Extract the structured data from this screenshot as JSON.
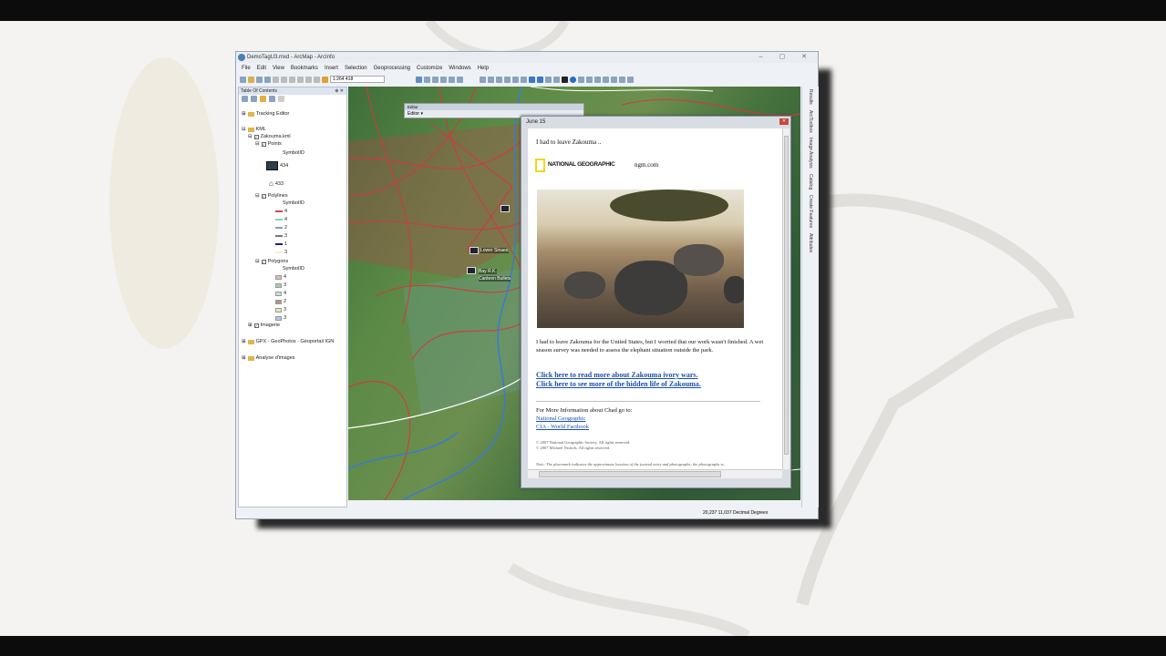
{
  "window": {
    "title": "DemoTagU3.mxd - ArcMap - ArcInfo",
    "controls": "–  ▢  ✕"
  },
  "menu": [
    "File",
    "Edit",
    "View",
    "Bookmarks",
    "Insert",
    "Selection",
    "Geoprocessing",
    "Customize",
    "Windows",
    "Help"
  ],
  "toolbar": {
    "scale": "1:264 418"
  },
  "toc": {
    "title": "Table Of Contents",
    "close": "⊕ ✕",
    "items": [
      {
        "label": "Tracking Editor"
      },
      {
        "label": "KML"
      },
      {
        "label": "Zakouma.kml"
      },
      {
        "label": "Points"
      },
      {
        "label": "SymbolID"
      },
      {
        "label": "434"
      },
      {
        "label": "433"
      },
      {
        "label": "Polylines"
      },
      {
        "label": "SymbolID"
      },
      {
        "label": "Polygons"
      },
      {
        "label": "SymbolID"
      },
      {
        "label": "Imagerie"
      },
      {
        "label": "GPX - GeoPhotos - Géoportail IGN"
      },
      {
        "label": "Analyse d'images"
      }
    ],
    "polyline_classes": [
      {
        "v": "4",
        "c": "#d24b4b"
      },
      {
        "v": "4",
        "c": "#8fd0b0"
      },
      {
        "v": "2",
        "c": "#7e9bd0"
      },
      {
        "v": "3",
        "c": "#777777"
      },
      {
        "v": "1",
        "c": "#1a1f7a"
      },
      {
        "v": "3",
        "c": "#f0f0d0"
      }
    ],
    "polygon_classes": [
      {
        "v": "4",
        "c": "#e8b8b0"
      },
      {
        "v": "3",
        "c": "#a8d0a8"
      },
      {
        "v": "4",
        "c": "#b8e8e0"
      },
      {
        "v": "2",
        "c": "#b09878"
      },
      {
        "v": "3",
        "c": "#e8e8b0"
      },
      {
        "v": "3",
        "c": "#a8d0e0"
      }
    ]
  },
  "editor": {
    "title": "Editor",
    "menu": "Editor ▾"
  },
  "map": {
    "labels": [
      "Lower Sinaed",
      "Bay R.K.",
      "Canteen Bullets"
    ]
  },
  "dock": [
    "Results",
    "ArcToolbox",
    "Image Analysis",
    "Catalog",
    "Create Features",
    "Attributes"
  ],
  "status": {
    "coords": "20,237  11,037 Decimal Degrees"
  },
  "popup": {
    "title": "June 15",
    "close": "✕",
    "heading": "I had to leave Zakouma ..",
    "brand": "NATIONAL GEOGRAPHIC",
    "site": "ngm.com",
    "body": "I had to leave Zakouma for the United States, but I worried that our work wasn't finished. A wet season survey was needed to assess the elephant situation outside the park.",
    "link1": "Click here to read more about Zakouma ivory wars.",
    "link2": "Click here to see more of the hidden life of Zakouma.",
    "more": "For More Information about Chad go to:",
    "ref1": "National Geographic",
    "ref2": "CIA - World Factbook",
    "copy1": "© 2007 National Geographic Society. All rights reserved.",
    "copy2": "© 2007 Michael Nichols. All rights reserved.",
    "note": "Note: The placemark indicates the approximate location of the journal entry and photographs; the photographs w..."
  }
}
